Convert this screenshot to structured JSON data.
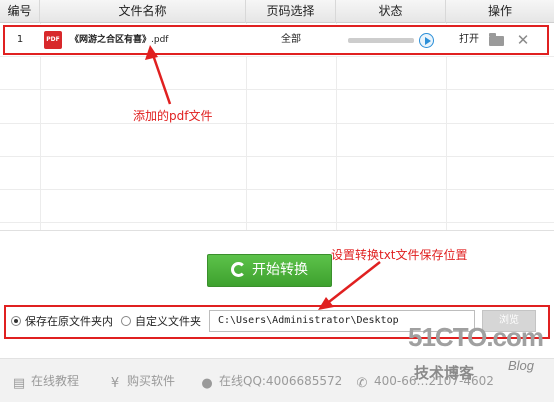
{
  "table": {
    "headers": [
      "编号",
      "文件名称",
      "页码选择",
      "状态",
      "操作"
    ],
    "row": {
      "number": "1",
      "pdf_icon_text": "PDF",
      "file_name_prefix": "《网游之合区有喜》",
      "file_name_ext": ".pdf",
      "pages": "全部",
      "progress": 0,
      "open_label": "打开"
    }
  },
  "annotations": {
    "added_pdf": "添加的pdf文件",
    "save_location": "设置转换txt文件保存位置"
  },
  "actions": {
    "start_label": "开始转换"
  },
  "save": {
    "option_original": "保存在原文件夹内",
    "option_custom": "自定义文件夹",
    "selected": "option_original",
    "path_value": "C:\\Users\\Administrator\\Desktop",
    "browse_label": "浏览"
  },
  "footer": {
    "tutorial": "在线教程",
    "buy": "购买软件",
    "qq": "在线QQ:4006685572",
    "phone": "400-66…2107-4602"
  },
  "watermark": {
    "logo": "51CTO.com",
    "sub": "技术博客",
    "blog": "Blog"
  },
  "colors": {
    "annotation_red": "#e02020",
    "start_green": "#4cb23b",
    "play_blue": "#2b8fd8",
    "pdf_red": "#d8282b"
  }
}
